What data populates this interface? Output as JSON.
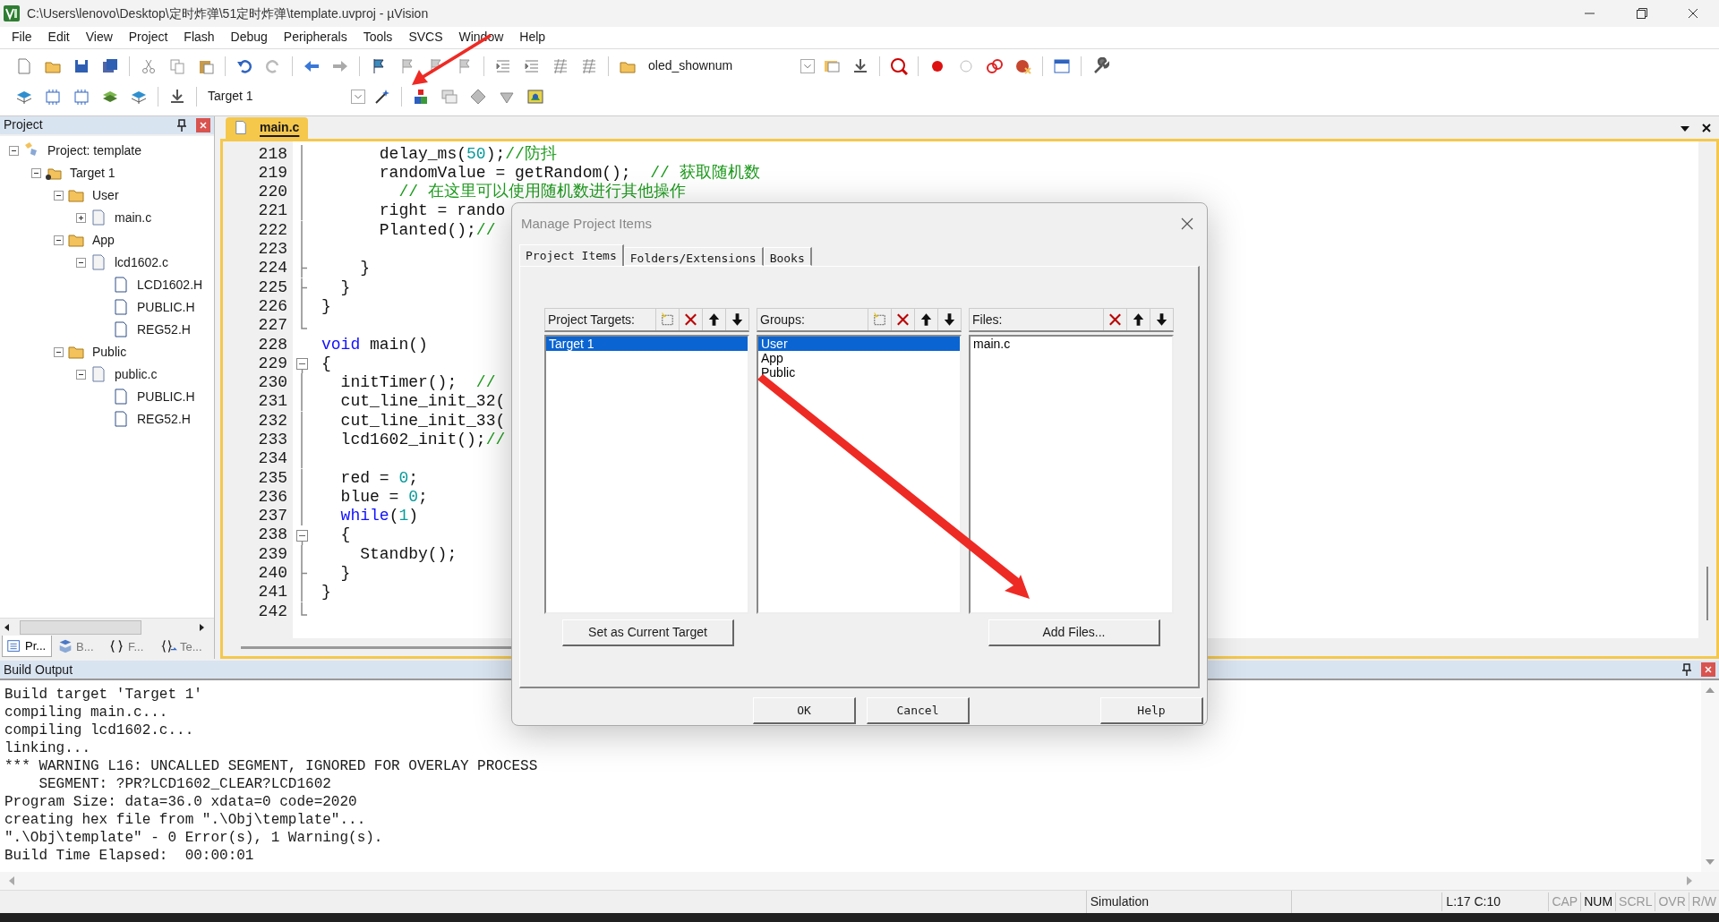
{
  "window": {
    "title": "C:\\Users\\lenovo\\Desktop\\定时炸弹\\51定时炸弹\\template.uvproj - µVision"
  },
  "menu": [
    "File",
    "Edit",
    "View",
    "Project",
    "Flash",
    "Debug",
    "Peripherals",
    "Tools",
    "SVCS",
    "Window",
    "Help"
  ],
  "toolbar": {
    "configuration": "oled_shownum",
    "target": "Target 1"
  },
  "project_panel": {
    "title": "Project",
    "tree": [
      {
        "label": "Project: template",
        "kind": "project",
        "expanded": true,
        "children": [
          {
            "label": "Target 1",
            "kind": "target",
            "expanded": true,
            "children": [
              {
                "label": "User",
                "kind": "group",
                "expanded": true,
                "children": [
                  {
                    "label": "main.c",
                    "kind": "source",
                    "expanded": false
                  }
                ]
              },
              {
                "label": "App",
                "kind": "group",
                "expanded": true,
                "children": [
                  {
                    "label": "lcd1602.c",
                    "kind": "source",
                    "expanded": true,
                    "children": [
                      {
                        "label": "LCD1602.H",
                        "kind": "header"
                      },
                      {
                        "label": "PUBLIC.H",
                        "kind": "header"
                      },
                      {
                        "label": "REG52.H",
                        "kind": "header"
                      }
                    ]
                  }
                ]
              },
              {
                "label": "Public",
                "kind": "group",
                "expanded": true,
                "children": [
                  {
                    "label": "public.c",
                    "kind": "source",
                    "expanded": true,
                    "children": [
                      {
                        "label": "PUBLIC.H",
                        "kind": "header"
                      },
                      {
                        "label": "REG52.H",
                        "kind": "header"
                      }
                    ]
                  }
                ]
              }
            ]
          }
        ]
      }
    ],
    "tabs": [
      {
        "label": "Pr...",
        "kind": "project",
        "selected": true
      },
      {
        "label": "B...",
        "kind": "books",
        "selected": false
      },
      {
        "label": "F...",
        "kind": "functions",
        "selected": false
      },
      {
        "label": "Te...",
        "kind": "templates",
        "selected": false
      }
    ]
  },
  "editor": {
    "tabs": [
      {
        "label": "main.c",
        "selected": true
      }
    ],
    "lines": [
      {
        "number": "218",
        "kind": "line",
        "code": [
          {
            "text": "      delay_ms(",
            "kind": "plain"
          },
          {
            "text": "50",
            "kind": "number"
          },
          {
            "text": ");",
            "kind": "plain"
          },
          {
            "text": "//防抖",
            "kind": "comment"
          }
        ]
      },
      {
        "number": "219",
        "kind": "line",
        "code": [
          {
            "text": "      randomValue = getRandom();  ",
            "kind": "plain"
          },
          {
            "text": "// 获取随机数",
            "kind": "comment"
          }
        ]
      },
      {
        "number": "220",
        "kind": "line",
        "code": [
          {
            "text": "        // 在这里可以使用随机数进行其他操作",
            "kind": "comment"
          }
        ]
      },
      {
        "number": "221",
        "kind": "line",
        "code": [
          {
            "text": "      right = rando",
            "kind": "plain"
          }
        ]
      },
      {
        "number": "222",
        "kind": "line",
        "code": [
          {
            "text": "      Planted();",
            "kind": "plain"
          },
          {
            "text": "//",
            "kind": "comment"
          }
        ]
      },
      {
        "number": "223",
        "kind": "line"
      },
      {
        "number": "224",
        "kind": "end",
        "code": [
          {
            "text": "    }",
            "kind": "plain"
          }
        ]
      },
      {
        "number": "225",
        "kind": "end",
        "code": [
          {
            "text": "  }",
            "kind": "plain"
          }
        ]
      },
      {
        "number": "226",
        "kind": "line",
        "code": [
          {
            "text": "}",
            "kind": "plain"
          }
        ]
      },
      {
        "number": "227",
        "kind": "last"
      },
      {
        "number": "228",
        "kind": "none",
        "code": [
          {
            "text": "void",
            "kind": "keyword"
          },
          {
            "text": " main()",
            "kind": "plain"
          }
        ]
      },
      {
        "number": "229",
        "kind": "open",
        "code": [
          {
            "text": "{",
            "kind": "plain"
          }
        ]
      },
      {
        "number": "230",
        "kind": "line",
        "code": [
          {
            "text": "  initTimer();  ",
            "kind": "plain"
          },
          {
            "text": "//",
            "kind": "comment"
          }
        ]
      },
      {
        "number": "231",
        "kind": "line",
        "code": [
          {
            "text": "  cut_line_init_32(",
            "kind": "plain"
          }
        ]
      },
      {
        "number": "232",
        "kind": "line",
        "code": [
          {
            "text": "  cut_line_init_33(",
            "kind": "plain"
          }
        ]
      },
      {
        "number": "233",
        "kind": "line",
        "code": [
          {
            "text": "  lcd1602_init();",
            "kind": "plain"
          },
          {
            "text": "//",
            "kind": "comment"
          }
        ]
      },
      {
        "number": "234",
        "kind": "line"
      },
      {
        "number": "235",
        "kind": "line",
        "code": [
          {
            "text": "  red = ",
            "kind": "plain"
          },
          {
            "text": "0",
            "kind": "number"
          },
          {
            "text": ";",
            "kind": "plain"
          }
        ]
      },
      {
        "number": "236",
        "kind": "line",
        "code": [
          {
            "text": "  blue = ",
            "kind": "plain"
          },
          {
            "text": "0",
            "kind": "number"
          },
          {
            "text": ";",
            "kind": "plain"
          }
        ]
      },
      {
        "number": "237",
        "kind": "line",
        "code": [
          {
            "text": "  while",
            "kind": "keyword"
          },
          {
            "text": "(",
            "kind": "plain"
          },
          {
            "text": "1",
            "kind": "number"
          },
          {
            "text": ")",
            "kind": "plain"
          }
        ]
      },
      {
        "number": "238",
        "kind": "open",
        "code": [
          {
            "text": "  {",
            "kind": "plain"
          }
        ]
      },
      {
        "number": "239",
        "kind": "line",
        "code": [
          {
            "text": "    Standby();",
            "kind": "plain"
          }
        ]
      },
      {
        "number": "240",
        "kind": "end",
        "code": [
          {
            "text": "  }",
            "kind": "plain"
          }
        ]
      },
      {
        "number": "241",
        "kind": "line",
        "code": [
          {
            "text": "}",
            "kind": "plain"
          }
        ]
      },
      {
        "number": "242",
        "kind": "last"
      }
    ]
  },
  "build_output": {
    "title": "Build Output",
    "lines": [
      "Build target 'Target 1'",
      "compiling main.c...",
      "compiling lcd1602.c...",
      "linking...",
      "*** WARNING L16: UNCALLED SEGMENT, IGNORED FOR OVERLAY PROCESS",
      "    SEGMENT: ?PR?LCD1602_CLEAR?LCD1602",
      "Program Size: data=36.0 xdata=0 code=2020",
      "creating hex file from \".\\Obj\\template\"...",
      "\".\\Obj\\template\" - 0 Error(s), 1 Warning(s).",
      "Build Time Elapsed:  00:00:01"
    ]
  },
  "status_bar": {
    "mode": "Simulation",
    "position": "L:17 C:10",
    "indicators": [
      {
        "label": "CAP",
        "on": false
      },
      {
        "label": "NUM",
        "on": true
      },
      {
        "label": "SCRL",
        "on": false
      },
      {
        "label": "OVR",
        "on": false
      },
      {
        "label": "R/W",
        "on": false
      }
    ]
  },
  "dialog": {
    "title": "Manage Project Items",
    "tabs": [
      {
        "label": "Project Items",
        "selected": true
      },
      {
        "label": "Folders/Extensions",
        "selected": false
      },
      {
        "label": "Books",
        "selected": false
      }
    ],
    "lists": [
      {
        "title": "Project Targets:",
        "can_add": true,
        "items": [
          {
            "label": "Target 1",
            "selected": true
          }
        ]
      },
      {
        "title": "Groups:",
        "can_add": true,
        "items": [
          {
            "label": "User",
            "selected": true
          },
          {
            "label": "App",
            "selected": false
          },
          {
            "label": "Public",
            "selected": false
          }
        ]
      },
      {
        "title": "Files:",
        "can_add": false,
        "items": [
          {
            "label": "main.c",
            "selected": false
          }
        ]
      }
    ],
    "list_buttons": [
      "Set as Current Target",
      "Add Files..."
    ],
    "buttons": [
      "OK",
      "Cancel",
      "Help"
    ]
  }
}
